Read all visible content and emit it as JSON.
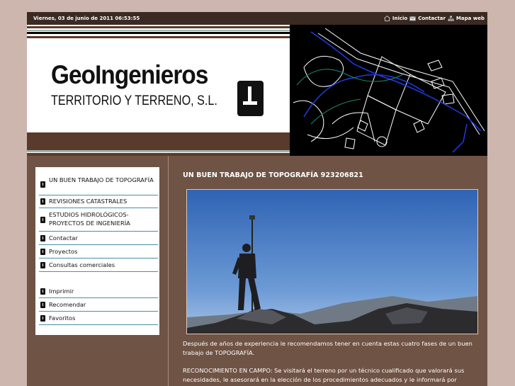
{
  "topbar": {
    "date": "Viernes, 03 de junio de 2011 06:53:55",
    "links": [
      {
        "label": "Inicio",
        "icon": "home-icon"
      },
      {
        "label": "Contactar",
        "icon": "mail-icon"
      },
      {
        "label": "Mapa web",
        "icon": "sitemap-icon"
      }
    ]
  },
  "banner": {
    "title": "GeoIngenieros",
    "subtitle": "TERRITORIO Y TERRENO, S.L."
  },
  "sidebar": {
    "items": [
      {
        "label": "UN BUEN TRABAJO DE TOPOGRAFÍA"
      },
      {
        "label": "REVISIONES CATASTRALES"
      },
      {
        "label": "ESTUDIOS HIDROLÓGICOS-PROYECTOS DE INGENIERÍA"
      },
      {
        "label": "Contactar"
      },
      {
        "label": "Proyectos"
      },
      {
        "label": "Consultas comerciales"
      }
    ],
    "tools": [
      {
        "label": "Imprimir"
      },
      {
        "label": "Recomendar"
      },
      {
        "label": "Favoritos"
      }
    ]
  },
  "main": {
    "title": "UN BUEN TRABAJO DE TOPOGRAFÍA 923206821",
    "paragraph1": "Después de años de experiencia le recomendamos tener en cuenta estas cuatro fases de un buen trabajo de TOPOGRAFÍA.",
    "paragraph2": "RECONOCIMIENTO EN CAMPO: Se visitará el terreno por un técnico cualificado que valorará sus necesidades, le asesorará en la elección de los procedimientos adecuados y le informará por"
  },
  "colors": {
    "page_bg": "#ccb6ad",
    "content_bg": "#6f5344",
    "topbar_bg": "#3a2a22",
    "menu_border": "#4a8fa8"
  }
}
